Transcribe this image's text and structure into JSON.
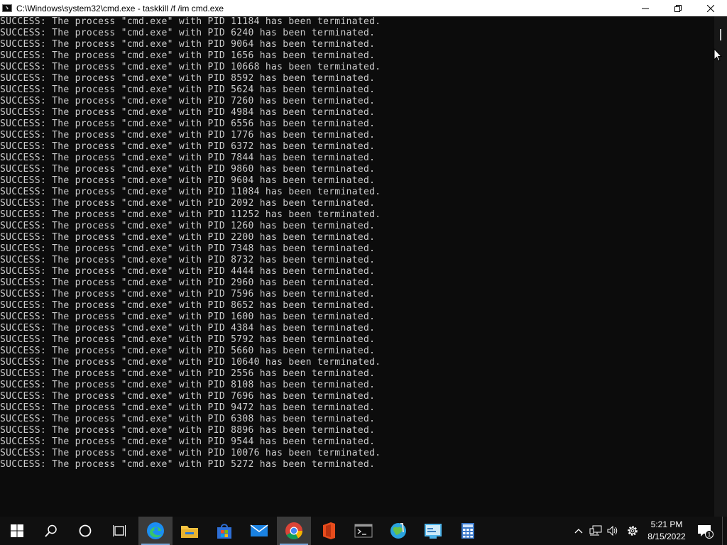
{
  "window": {
    "title": "C:\\Windows\\system32\\cmd.exe - taskkill  /f /im cmd.exe"
  },
  "console": {
    "lines": [
      "SUCCESS: The process \"cmd.exe\" with PID 11184 has been terminated.",
      "SUCCESS: The process \"cmd.exe\" with PID 6240 has been terminated.",
      "SUCCESS: The process \"cmd.exe\" with PID 9064 has been terminated.",
      "SUCCESS: The process \"cmd.exe\" with PID 1656 has been terminated.",
      "SUCCESS: The process \"cmd.exe\" with PID 10668 has been terminated.",
      "SUCCESS: The process \"cmd.exe\" with PID 8592 has been terminated.",
      "SUCCESS: The process \"cmd.exe\" with PID 5624 has been terminated.",
      "SUCCESS: The process \"cmd.exe\" with PID 7260 has been terminated.",
      "SUCCESS: The process \"cmd.exe\" with PID 4984 has been terminated.",
      "SUCCESS: The process \"cmd.exe\" with PID 6556 has been terminated.",
      "SUCCESS: The process \"cmd.exe\" with PID 1776 has been terminated.",
      "SUCCESS: The process \"cmd.exe\" with PID 6372 has been terminated.",
      "SUCCESS: The process \"cmd.exe\" with PID 7844 has been terminated.",
      "SUCCESS: The process \"cmd.exe\" with PID 9860 has been terminated.",
      "SUCCESS: The process \"cmd.exe\" with PID 9604 has been terminated.",
      "SUCCESS: The process \"cmd.exe\" with PID 11084 has been terminated.",
      "SUCCESS: The process \"cmd.exe\" with PID 2092 has been terminated.",
      "SUCCESS: The process \"cmd.exe\" with PID 11252 has been terminated.",
      "SUCCESS: The process \"cmd.exe\" with PID 1260 has been terminated.",
      "SUCCESS: The process \"cmd.exe\" with PID 2200 has been terminated.",
      "SUCCESS: The process \"cmd.exe\" with PID 7348 has been terminated.",
      "SUCCESS: The process \"cmd.exe\" with PID 8732 has been terminated.",
      "SUCCESS: The process \"cmd.exe\" with PID 4444 has been terminated.",
      "SUCCESS: The process \"cmd.exe\" with PID 2960 has been terminated.",
      "SUCCESS: The process \"cmd.exe\" with PID 7596 has been terminated.",
      "SUCCESS: The process \"cmd.exe\" with PID 8652 has been terminated.",
      "SUCCESS: The process \"cmd.exe\" with PID 1600 has been terminated.",
      "SUCCESS: The process \"cmd.exe\" with PID 4384 has been terminated.",
      "SUCCESS: The process \"cmd.exe\" with PID 5792 has been terminated.",
      "SUCCESS: The process \"cmd.exe\" with PID 5660 has been terminated.",
      "SUCCESS: The process \"cmd.exe\" with PID 10640 has been terminated.",
      "SUCCESS: The process \"cmd.exe\" with PID 2556 has been terminated.",
      "SUCCESS: The process \"cmd.exe\" with PID 8108 has been terminated.",
      "SUCCESS: The process \"cmd.exe\" with PID 7696 has been terminated.",
      "SUCCESS: The process \"cmd.exe\" with PID 9472 has been terminated.",
      "SUCCESS: The process \"cmd.exe\" with PID 6308 has been terminated.",
      "SUCCESS: The process \"cmd.exe\" with PID 8896 has been terminated.",
      "SUCCESS: The process \"cmd.exe\" with PID 9544 has been terminated.",
      "SUCCESS: The process \"cmd.exe\" with PID 10076 has been terminated.",
      "SUCCESS: The process \"cmd.exe\" with PID 5272 has been terminated."
    ]
  },
  "taskbar": {
    "apps": [
      {
        "icon": "edge-icon",
        "active": true
      },
      {
        "icon": "file-explorer-icon",
        "active": false
      },
      {
        "icon": "microsoft-store-icon",
        "active": false
      },
      {
        "icon": "mail-icon",
        "active": false
      },
      {
        "icon": "chrome-icon",
        "active": true
      },
      {
        "icon": "office-icon",
        "active": false
      },
      {
        "icon": "command-prompt-icon",
        "active": false
      },
      {
        "icon": "maps-icon",
        "active": false
      },
      {
        "icon": "control-panel-icon",
        "active": false
      },
      {
        "icon": "calculator-icon",
        "active": false
      }
    ],
    "clock": {
      "time": "5:21 PM",
      "date": "8/15/2022"
    },
    "notification_count": "1"
  },
  "colors": {
    "console_bg": "#0c0c0c",
    "console_text": "#cccccc",
    "taskbar_bg": "#101010",
    "edge_blue": "#1b8ef2",
    "chrome_active": "#3b3b3b"
  }
}
